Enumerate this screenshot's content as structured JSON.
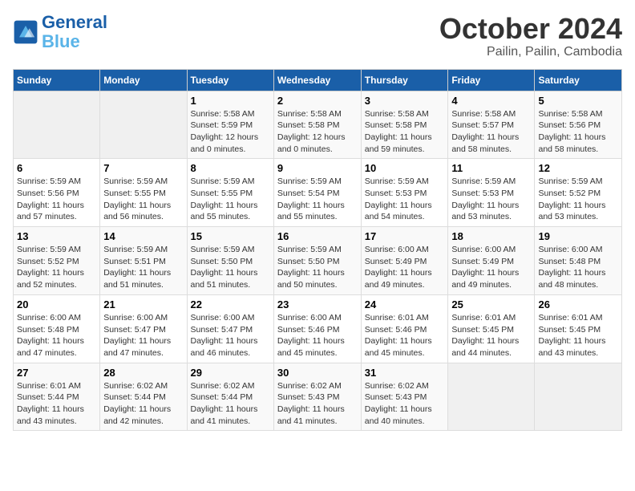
{
  "header": {
    "logo_line1": "General",
    "logo_line2": "Blue",
    "title": "October 2024",
    "subtitle": "Pailin, Pailin, Cambodia"
  },
  "days_of_week": [
    "Sunday",
    "Monday",
    "Tuesday",
    "Wednesday",
    "Thursday",
    "Friday",
    "Saturday"
  ],
  "weeks": [
    [
      {
        "day": "",
        "info": ""
      },
      {
        "day": "",
        "info": ""
      },
      {
        "day": "1",
        "info": "Sunrise: 5:58 AM\nSunset: 5:59 PM\nDaylight: 12 hours and 0 minutes."
      },
      {
        "day": "2",
        "info": "Sunrise: 5:58 AM\nSunset: 5:58 PM\nDaylight: 12 hours and 0 minutes."
      },
      {
        "day": "3",
        "info": "Sunrise: 5:58 AM\nSunset: 5:58 PM\nDaylight: 11 hours and 59 minutes."
      },
      {
        "day": "4",
        "info": "Sunrise: 5:58 AM\nSunset: 5:57 PM\nDaylight: 11 hours and 58 minutes."
      },
      {
        "day": "5",
        "info": "Sunrise: 5:58 AM\nSunset: 5:56 PM\nDaylight: 11 hours and 58 minutes."
      }
    ],
    [
      {
        "day": "6",
        "info": "Sunrise: 5:59 AM\nSunset: 5:56 PM\nDaylight: 11 hours and 57 minutes."
      },
      {
        "day": "7",
        "info": "Sunrise: 5:59 AM\nSunset: 5:55 PM\nDaylight: 11 hours and 56 minutes."
      },
      {
        "day": "8",
        "info": "Sunrise: 5:59 AM\nSunset: 5:55 PM\nDaylight: 11 hours and 55 minutes."
      },
      {
        "day": "9",
        "info": "Sunrise: 5:59 AM\nSunset: 5:54 PM\nDaylight: 11 hours and 55 minutes."
      },
      {
        "day": "10",
        "info": "Sunrise: 5:59 AM\nSunset: 5:53 PM\nDaylight: 11 hours and 54 minutes."
      },
      {
        "day": "11",
        "info": "Sunrise: 5:59 AM\nSunset: 5:53 PM\nDaylight: 11 hours and 53 minutes."
      },
      {
        "day": "12",
        "info": "Sunrise: 5:59 AM\nSunset: 5:52 PM\nDaylight: 11 hours and 53 minutes."
      }
    ],
    [
      {
        "day": "13",
        "info": "Sunrise: 5:59 AM\nSunset: 5:52 PM\nDaylight: 11 hours and 52 minutes."
      },
      {
        "day": "14",
        "info": "Sunrise: 5:59 AM\nSunset: 5:51 PM\nDaylight: 11 hours and 51 minutes."
      },
      {
        "day": "15",
        "info": "Sunrise: 5:59 AM\nSunset: 5:50 PM\nDaylight: 11 hours and 51 minutes."
      },
      {
        "day": "16",
        "info": "Sunrise: 5:59 AM\nSunset: 5:50 PM\nDaylight: 11 hours and 50 minutes."
      },
      {
        "day": "17",
        "info": "Sunrise: 6:00 AM\nSunset: 5:49 PM\nDaylight: 11 hours and 49 minutes."
      },
      {
        "day": "18",
        "info": "Sunrise: 6:00 AM\nSunset: 5:49 PM\nDaylight: 11 hours and 49 minutes."
      },
      {
        "day": "19",
        "info": "Sunrise: 6:00 AM\nSunset: 5:48 PM\nDaylight: 11 hours and 48 minutes."
      }
    ],
    [
      {
        "day": "20",
        "info": "Sunrise: 6:00 AM\nSunset: 5:48 PM\nDaylight: 11 hours and 47 minutes."
      },
      {
        "day": "21",
        "info": "Sunrise: 6:00 AM\nSunset: 5:47 PM\nDaylight: 11 hours and 47 minutes."
      },
      {
        "day": "22",
        "info": "Sunrise: 6:00 AM\nSunset: 5:47 PM\nDaylight: 11 hours and 46 minutes."
      },
      {
        "day": "23",
        "info": "Sunrise: 6:00 AM\nSunset: 5:46 PM\nDaylight: 11 hours and 45 minutes."
      },
      {
        "day": "24",
        "info": "Sunrise: 6:01 AM\nSunset: 5:46 PM\nDaylight: 11 hours and 45 minutes."
      },
      {
        "day": "25",
        "info": "Sunrise: 6:01 AM\nSunset: 5:45 PM\nDaylight: 11 hours and 44 minutes."
      },
      {
        "day": "26",
        "info": "Sunrise: 6:01 AM\nSunset: 5:45 PM\nDaylight: 11 hours and 43 minutes."
      }
    ],
    [
      {
        "day": "27",
        "info": "Sunrise: 6:01 AM\nSunset: 5:44 PM\nDaylight: 11 hours and 43 minutes."
      },
      {
        "day": "28",
        "info": "Sunrise: 6:02 AM\nSunset: 5:44 PM\nDaylight: 11 hours and 42 minutes."
      },
      {
        "day": "29",
        "info": "Sunrise: 6:02 AM\nSunset: 5:44 PM\nDaylight: 11 hours and 41 minutes."
      },
      {
        "day": "30",
        "info": "Sunrise: 6:02 AM\nSunset: 5:43 PM\nDaylight: 11 hours and 41 minutes."
      },
      {
        "day": "31",
        "info": "Sunrise: 6:02 AM\nSunset: 5:43 PM\nDaylight: 11 hours and 40 minutes."
      },
      {
        "day": "",
        "info": ""
      },
      {
        "day": "",
        "info": ""
      }
    ]
  ]
}
